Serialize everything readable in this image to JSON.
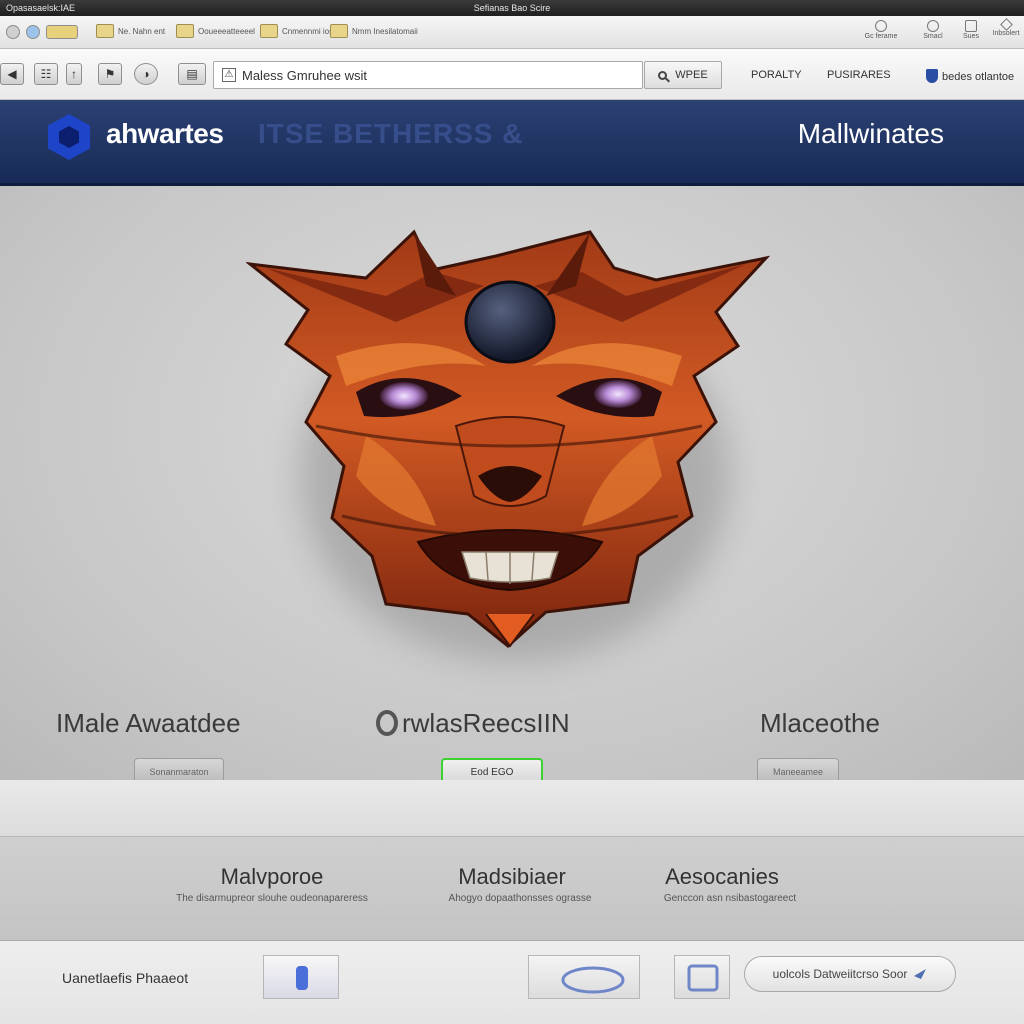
{
  "window": {
    "app_label": "Opasasaelsk:IAE",
    "title": "Sefianas Bao Scire"
  },
  "bookmarks": [
    {
      "label": "Ne. Nahn ent"
    },
    {
      "label": "Ooueeeatteeeel"
    },
    {
      "label": "Cnmennmi ioseri"
    },
    {
      "label": "Nmm Inesilatomaii"
    }
  ],
  "toolbar_right": [
    {
      "label": "Gc ferame"
    },
    {
      "label": "Smacl"
    },
    {
      "label": "Sues"
    },
    {
      "label": "Inbsolert"
    }
  ],
  "address_bar": {
    "value": "Maless Gmruhee wsit"
  },
  "search_button": {
    "label": "WPEE"
  },
  "top_nav": {
    "link1": "PORALTY",
    "link2": "PUSIRARES",
    "link3": "bedes otlantoe"
  },
  "header": {
    "brand": "ahwartes",
    "ghost": "ITSE  BETHERSS &",
    "right_title": "Mallwinates"
  },
  "columns": [
    {
      "title": "IMale Awaatdee",
      "button": "Sonanmaraton"
    },
    {
      "title": "rwlasReecsIIN",
      "button": "Eod EGO"
    },
    {
      "title": "Mlaceothe",
      "button": "Maneeamee"
    }
  ],
  "features": [
    {
      "title": "Malvporoe",
      "desc": "The disarmupreor slouhe oudeonapareress"
    },
    {
      "title": "Madsibiaer",
      "desc": "Ahogyo dopaathonsses ograsse"
    },
    {
      "title": "Aesocanies",
      "desc": "Genccon asn nsibastogareect"
    }
  ],
  "footer": {
    "label": "Uanetlaefis Phaaeot",
    "button": "uolcols Datweiitcrso Soor"
  },
  "colors": {
    "header_blue": "#1f3264",
    "logo_blue": "#1e44c8",
    "cta_green": "#3ecf32",
    "mask_orange": "#c8501e"
  }
}
